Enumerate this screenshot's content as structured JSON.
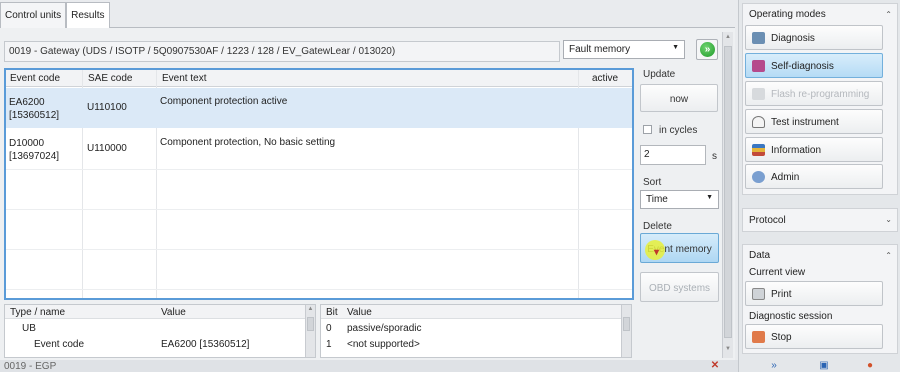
{
  "tabs": [
    "Control units",
    "Results"
  ],
  "gateway": {
    "text": "0019 - Gateway  (UDS / ISOTP / 5Q0907530AF / 1223 / 128 / EV_GatewLear / 013020)",
    "select_value": "Fault memory",
    "go_symbol": "»"
  },
  "events": {
    "headers": [
      "Event code",
      "SAE code",
      "Event text",
      "active"
    ],
    "rows": [
      {
        "code_line1": "EA6200",
        "code_line2": "[15360512]",
        "sae": "U110100",
        "text": "Component protection active",
        "active": ""
      },
      {
        "code_line1": "D10000",
        "code_line2": "[13697024]",
        "sae": "U110000",
        "text": "Component protection, No basic setting",
        "active": ""
      }
    ]
  },
  "controls": {
    "update_label": "Update",
    "now_button": "now",
    "in_cycles_label": "in cycles",
    "cycles_value": "2",
    "cycles_unit": "s",
    "sort_label": "Sort",
    "sort_value": "Time",
    "delete_label": "Delete",
    "event_memory_button": "Event memory",
    "obd_systems_button": "OBD systems"
  },
  "detail_left": {
    "headers": [
      "Type / name",
      "Value"
    ],
    "rows": [
      {
        "name": "UB",
        "value": ""
      },
      {
        "name": "Event code",
        "value": "EA6200 [15360512]"
      }
    ]
  },
  "detail_right": {
    "headers": [
      "Bit",
      "Value"
    ],
    "rows": [
      {
        "bit": "0",
        "value": "passive/sporadic"
      },
      {
        "bit": "1",
        "value": "<not supported>"
      }
    ]
  },
  "sidebar": {
    "operating_modes_title": "Operating modes",
    "modes": [
      {
        "label": "Diagnosis",
        "icon": "stethoscope-icon",
        "state": "normal"
      },
      {
        "label": "Self-diagnosis",
        "icon": "self-diagnosis-icon",
        "state": "active"
      },
      {
        "label": "Flash re-programming",
        "icon": "flash-icon",
        "state": "disabled"
      },
      {
        "label": "Test instrument",
        "icon": "gauge-icon",
        "state": "normal"
      },
      {
        "label": "Information",
        "icon": "books-icon",
        "state": "normal"
      },
      {
        "label": "Admin",
        "icon": "admin-icon",
        "state": "normal"
      }
    ],
    "protocol_title": "Protocol",
    "data_title": "Data",
    "current_view_label": "Current view",
    "print_button": "Print",
    "diagnostic_session_label": "Diagnostic session",
    "stop_button": "Stop"
  },
  "status_text": "0019 - EGP",
  "colors": {
    "accent_blue": "#5a9bd8",
    "selected_row": "#dbe9f7",
    "go_green": "#1f9a2a",
    "cursor_yellow": "#e8f03a"
  }
}
